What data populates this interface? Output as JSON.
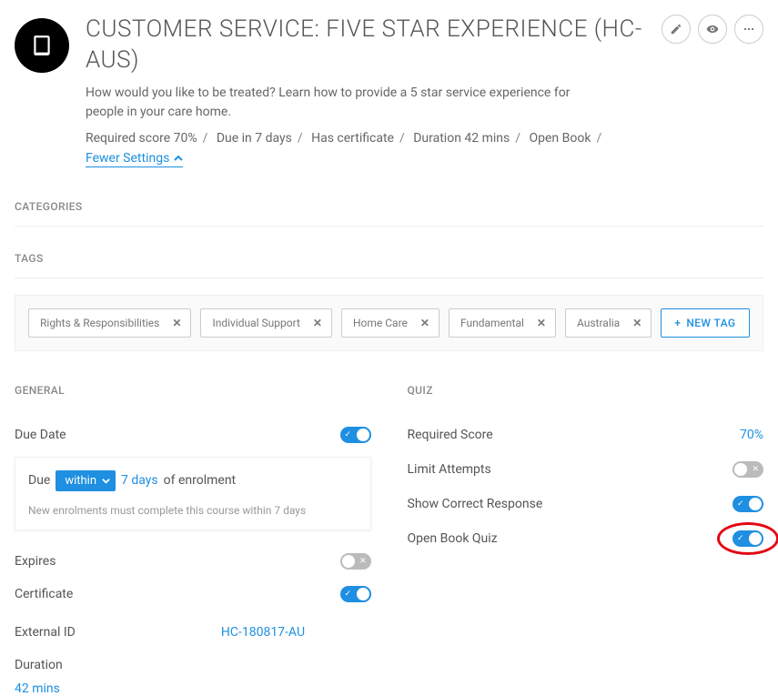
{
  "header": {
    "title": "CUSTOMER SERVICE: FIVE STAR EXPERIENCE (HC-AUS)",
    "description": "How would you like to be treated? Learn how to provide a 5 star service experience for people in your care home.",
    "meta": {
      "required_score": "Required score 70%",
      "due": "Due in 7 days",
      "certificate": "Has certificate",
      "duration": "Duration 42 mins",
      "open_book": "Open Book"
    },
    "fewer_settings": "Fewer Settings"
  },
  "sections": {
    "categories": "CATEGORIES",
    "tags": "TAGS",
    "general": "GENERAL",
    "quiz": "QUIZ"
  },
  "tags": [
    "Rights & Responsibilities",
    "Individual Support",
    "Home Care",
    "Fundamental",
    "Australia"
  ],
  "new_tag_label": "NEW TAG",
  "general": {
    "due_date": {
      "label": "Due Date",
      "on": true
    },
    "due_card": {
      "prefix": "Due",
      "mode": "within",
      "days": "7 days",
      "suffix": "of enrolment",
      "note": "New enrolments must complete this course within 7 days"
    },
    "expires": {
      "label": "Expires",
      "on": false
    },
    "certificate": {
      "label": "Certificate",
      "on": true
    },
    "external_id": {
      "label": "External ID",
      "value": "HC-180817-AU"
    },
    "duration": {
      "label": "Duration",
      "value": "42 mins"
    }
  },
  "quiz": {
    "required_score": {
      "label": "Required Score",
      "value": "70%"
    },
    "limit_attempts": {
      "label": "Limit Attempts",
      "on": false
    },
    "show_correct": {
      "label": "Show Correct Response",
      "on": true
    },
    "open_book": {
      "label": "Open Book Quiz",
      "on": true
    }
  }
}
